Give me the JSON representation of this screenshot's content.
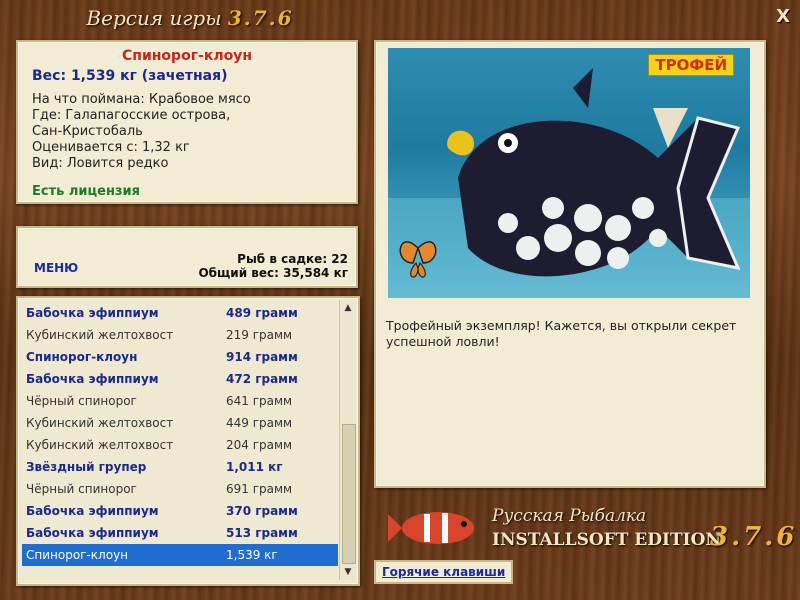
{
  "header": {
    "title": "Версия игры",
    "version": "3.7.6",
    "close_label": "X"
  },
  "fish_info": {
    "name": "Спинорог-клоун",
    "weight": "Вес: 1,539 кг (зачетная)",
    "bait": "На что поймана: Крабовое мясо",
    "where_1": "Где: Галапагосские острова,",
    "where_2": "Сан-Кристобаль",
    "value": "Оценивается с: 1,32 кг",
    "kind": "Вид: Ловится редко",
    "license": "Есть лицензия"
  },
  "stats": {
    "menu_label": "МЕНЮ",
    "count": "Рыб в садке: 22",
    "total": "Общий вес: 35,584 кг"
  },
  "catch_list": [
    {
      "name": "Бабочка эфиппиум",
      "weight": "489 грамм",
      "style": "bold"
    },
    {
      "name": "Кубинский желтохвост",
      "weight": "219 грамм",
      "style": "plain"
    },
    {
      "name": "Спинорог-клоун",
      "weight": "914 грамм",
      "style": "bold"
    },
    {
      "name": "Бабочка эфиппиум",
      "weight": "472 грамм",
      "style": "bold"
    },
    {
      "name": "Чёрный спинорог",
      "weight": "641 грамм",
      "style": "plain"
    },
    {
      "name": "Кубинский желтохвост",
      "weight": "449 грамм",
      "style": "plain"
    },
    {
      "name": "Кубинский желтохвост",
      "weight": "204 грамм",
      "style": "plain"
    },
    {
      "name": "Звёздный групер",
      "weight": "1,011 кг",
      "style": "bold"
    },
    {
      "name": "Чёрный спинорог",
      "weight": "691 грамм",
      "style": "plain"
    },
    {
      "name": "Бабочка эфиппиум",
      "weight": "370 грамм",
      "style": "bold"
    },
    {
      "name": "Бабочка эфиппиум",
      "weight": "513 грамм",
      "style": "bold"
    },
    {
      "name": "Спинорог-клоун",
      "weight": "1,539 кг",
      "style": "sel"
    }
  ],
  "photo": {
    "trophy_label": "ТРОФЕЙ"
  },
  "description": "Трофейный экземпляр! Кажется, вы открыли секрет успешной ловли!",
  "brand": {
    "line1": "Русская Рыбалка",
    "line2": "INSTALLSOFT EDITION",
    "version": "3.7.6"
  },
  "hotkeys_label": "Горячие клавиши",
  "colors": {
    "accent_red": "#c4261d",
    "accent_blue": "#1a2a8a",
    "license_green": "#1b7a23",
    "selection": "#1f6dd0"
  }
}
